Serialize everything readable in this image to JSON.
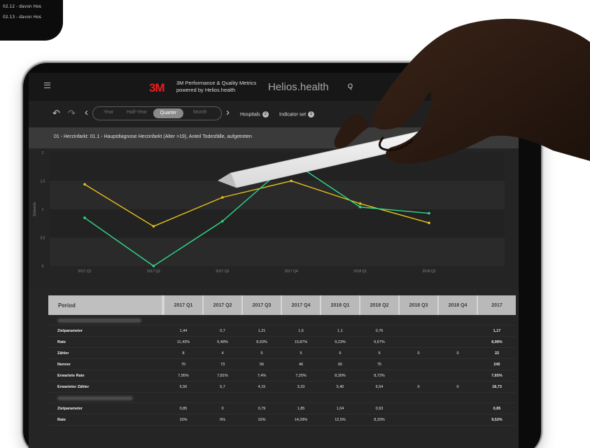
{
  "phone": {
    "lines": [
      "02.12 - davon Hos",
      "02.13 - davon Hos"
    ]
  },
  "app": {
    "menu_icon": "hamburger-icon",
    "logo": "3M",
    "tagline_1": "3M Performance & Quality Metrics",
    "tagline_2": "powered by Helios.health",
    "brand": "Helios.health",
    "header_right": "Q"
  },
  "toolbar": {
    "back_icon": "reply-arrow-icon",
    "forward_icon": "forward-arrow-icon",
    "prev_icon": "chevron-left-icon",
    "next_icon": "chevron-right-icon",
    "periods": [
      "Year",
      "Half-Year",
      "Quarter",
      "Month"
    ],
    "active_period": "Quarter",
    "hospitals_label": "Hospitals",
    "hospitals_count": "2",
    "indicator_label": "Indicator set",
    "indicator_count": "1"
  },
  "indicator_title": "01 - Herzinfarkt: 01.1 - Hauptdiagnose Herzinfarkt (Alter >19), Anteil Todesfälle, aufgetreten",
  "chart_data": {
    "type": "line",
    "categories": [
      "2017 Q1",
      "2017 Q2",
      "2017 Q3",
      "2017 Q4",
      "2018 Q1",
      "2018 Q2"
    ],
    "ylabel": "Zielwerte",
    "yticks": [
      "0",
      "0,5",
      "1",
      "1,5",
      "2"
    ],
    "ylim": [
      0,
      2
    ],
    "series": [
      {
        "color": "#e8c21c",
        "values": [
          1.44,
          0.7,
          1.21,
          1.5,
          1.1,
          0.76
        ]
      },
      {
        "color": "#2fd987",
        "values": [
          0.85,
          0.0,
          0.79,
          1.85,
          1.04,
          0.93
        ]
      }
    ]
  },
  "table": {
    "header_period": "Period",
    "columns": [
      "2017 Q1",
      "2017 Q2",
      "2017 Q3",
      "2017 Q4",
      "2018 Q1",
      "2018 Q2",
      "2018 Q3",
      "2018 Q4",
      "2017"
    ],
    "sections": [
      {
        "rows": [
          {
            "label": "Zielparameter",
            "values": [
              "1,44",
              "0,7",
              "1,21",
              "1,5",
              "1,1",
              "0,76",
              "",
              "",
              "1,17"
            ]
          },
          {
            "label": "Rate",
            "values": [
              "11,43%",
              "5,48%",
              "8,93%",
              "10,87%",
              "9,23%",
              "6,67%",
              "",
              "",
              "8,98%"
            ]
          },
          {
            "label": "Zähler",
            "values": [
              "8",
              "4",
              "5",
              "5",
              "6",
              "5",
              "0",
              "0",
              "22"
            ]
          },
          {
            "label": "Nenner",
            "values": [
              "70",
              "73",
              "56",
              "46",
              "65",
              "75",
              "",
              "",
              "245"
            ]
          },
          {
            "label": "Erwartete Rate",
            "values": [
              "7,95%",
              "7,81%",
              "7,4%",
              "7,25%",
              "8,30%",
              "8,72%",
              "",
              "",
              "7,65%"
            ]
          },
          {
            "label": "Erwarteter Zähler",
            "values": [
              "5,56",
              "5,7",
              "4,15",
              "3,33",
              "5,40",
              "6,54",
              "0",
              "0",
              "18,73"
            ]
          }
        ]
      },
      {
        "rows": [
          {
            "label": "Zielparameter",
            "values": [
              "0,85",
              "0",
              "0,79",
              "1,85",
              "1,04",
              "0,93",
              "",
              "",
              "0,85"
            ]
          },
          {
            "label": "Rate",
            "values": [
              "10%",
              "0%",
              "10%",
              "14,29%",
              "12,5%",
              "8,33%",
              "",
              "",
              "9,52%"
            ]
          }
        ]
      }
    ]
  }
}
